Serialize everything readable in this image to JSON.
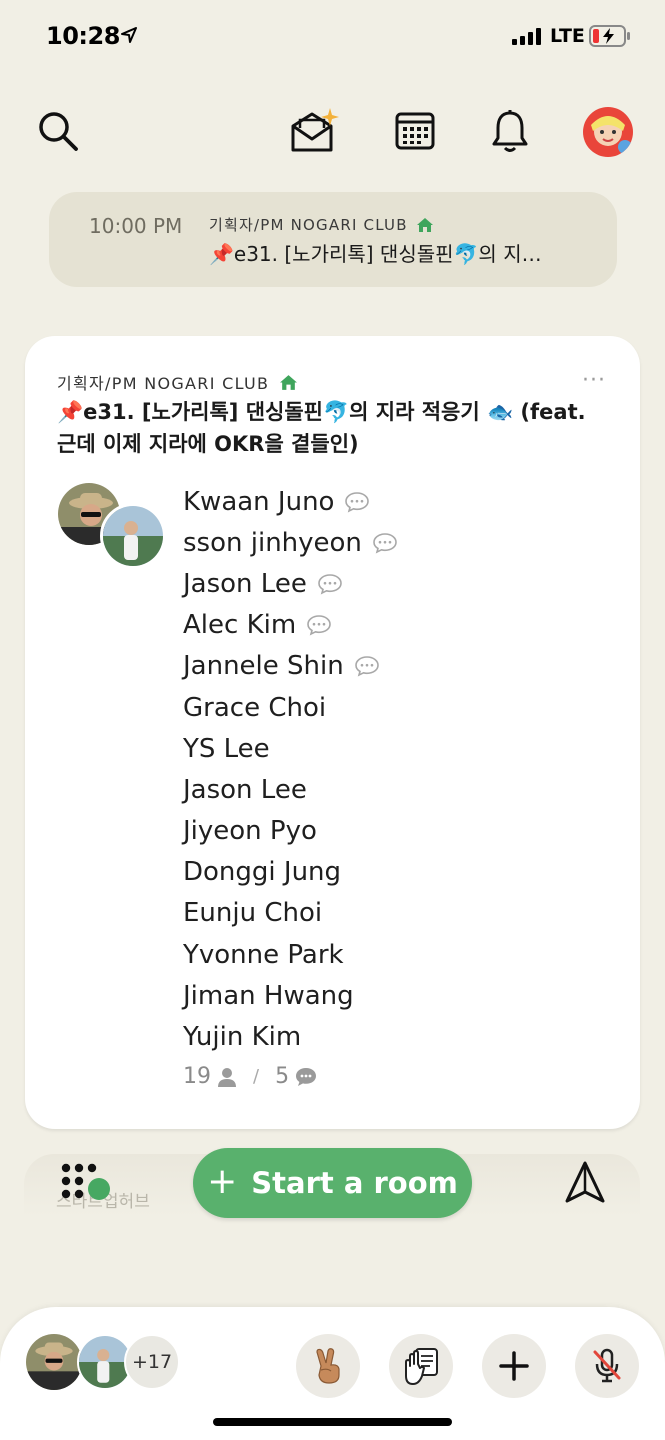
{
  "status_bar": {
    "time": "10:28",
    "network": "LTE"
  },
  "top_nav": {
    "icons": [
      "search-icon",
      "invite-envelope-icon",
      "calendar-icon",
      "bell-icon",
      "profile-avatar"
    ]
  },
  "upcoming": {
    "time": "10:00 PM",
    "club": "기획자/PM NOGARI CLUB",
    "title": "📌e31. [노가리톡] 댄싱돌핀🐬의 지…"
  },
  "room": {
    "club": "기획자/PM NOGARI CLUB",
    "title": "📌e31. [노가리톡] 댄싱돌핀🐬의 지라 적응기 🐟 (feat. 근데 이제 지라에 OKR을 곁들인)",
    "more": "···",
    "speakers": [
      {
        "name": "Kwaan Juno",
        "speaking": true
      },
      {
        "name": "sson jinhyeon",
        "speaking": true
      },
      {
        "name": "Jason Lee",
        "speaking": true
      },
      {
        "name": "Alec Kim",
        "speaking": true
      },
      {
        "name": "Jannele Shin",
        "speaking": true
      },
      {
        "name": "Grace Choi",
        "speaking": false
      },
      {
        "name": "YS Lee",
        "speaking": false
      },
      {
        "name": "Jason Lee",
        "speaking": false
      },
      {
        "name": "Jiyeon Pyo",
        "speaking": false
      },
      {
        "name": "Donggi Jung",
        "speaking": false
      },
      {
        "name": "Eunju Choi",
        "speaking": false
      },
      {
        "name": "Yvonne Park",
        "speaking": false
      },
      {
        "name": "Jiman Hwang",
        "speaking": false
      },
      {
        "name": "Yujin Kim",
        "speaking": false
      }
    ],
    "listener_count": "19",
    "separator": "/",
    "speaker_count": "5"
  },
  "strip": {
    "hint": "스타트업허브"
  },
  "start_room": {
    "label": "Start a room",
    "icon": "+"
  },
  "bottom_panel": {
    "more_count": "+17",
    "actions": [
      "peace-hand-icon",
      "raise-hand-icon",
      "add-icon",
      "mic-muted-icon"
    ]
  },
  "colors": {
    "background": "#f1efe5",
    "accent_green": "#59b16d",
    "mini_card": "#e5e2d3"
  }
}
